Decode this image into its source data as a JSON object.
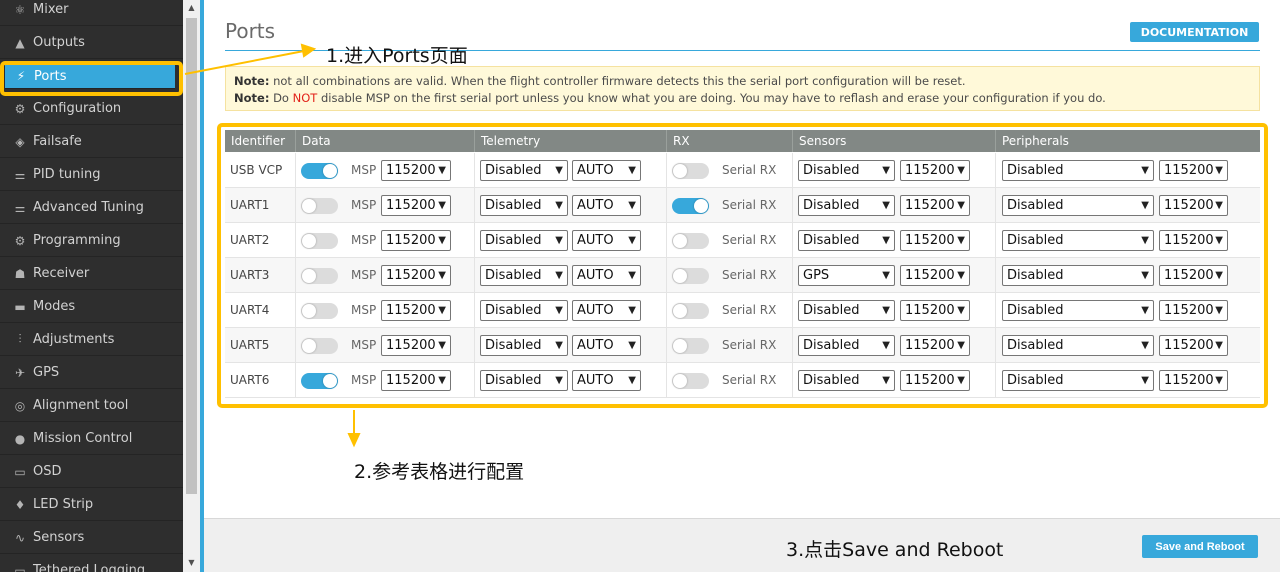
{
  "sidebar": {
    "items": [
      {
        "label": "Mixer",
        "icon": "mixer-icon",
        "glyph": "⚛"
      },
      {
        "label": "Outputs",
        "icon": "outputs-icon",
        "glyph": "▲"
      },
      {
        "label": "Ports",
        "icon": "ports-icon",
        "glyph": "⚡",
        "active": true
      },
      {
        "label": "Configuration",
        "icon": "gear-icon",
        "glyph": "⚙"
      },
      {
        "label": "Failsafe",
        "icon": "failsafe-icon",
        "glyph": "◈"
      },
      {
        "label": "PID tuning",
        "icon": "pid-icon",
        "glyph": "⚌"
      },
      {
        "label": "Advanced Tuning",
        "icon": "advanced-tuning-icon",
        "glyph": "⚌"
      },
      {
        "label": "Programming",
        "icon": "gear-icon",
        "glyph": "⚙"
      },
      {
        "label": "Receiver",
        "icon": "receiver-icon",
        "glyph": "☗"
      },
      {
        "label": "Modes",
        "icon": "modes-icon",
        "glyph": "▬"
      },
      {
        "label": "Adjustments",
        "icon": "adjustments-icon",
        "glyph": "⫶"
      },
      {
        "label": "GPS",
        "icon": "gps-icon",
        "glyph": "✈"
      },
      {
        "label": "Alignment tool",
        "icon": "alignment-icon",
        "glyph": "◎"
      },
      {
        "label": "Mission Control",
        "icon": "map-pin-icon",
        "glyph": "●"
      },
      {
        "label": "OSD",
        "icon": "osd-icon",
        "glyph": "▭"
      },
      {
        "label": "LED Strip",
        "icon": "led-icon",
        "glyph": "♦"
      },
      {
        "label": "Sensors",
        "icon": "sensors-icon",
        "glyph": "∿"
      },
      {
        "label": "Tethered Logging",
        "icon": "logging-icon",
        "glyph": "▭"
      }
    ]
  },
  "header": {
    "title": "Ports",
    "doc_label": "DOCUMENTATION"
  },
  "note": {
    "line1_bold": "Note:",
    "line1": " not all combinations are valid. When the flight controller firmware detects this the serial port configuration will be reset.",
    "line2_bold": "Note:",
    "line2_a": " Do ",
    "line2_red": "NOT",
    "line2_b": " disable MSP on the first serial port unless you know what you are doing. You may have to reflash and erase your configuration if you do."
  },
  "table": {
    "headers": [
      "Identifier",
      "Data",
      "Telemetry",
      "RX",
      "Sensors",
      "Peripherals"
    ],
    "msp_label": "MSP",
    "serial_rx_label": "Serial RX",
    "rows": [
      {
        "id": "USB VCP",
        "msp_on": true,
        "msp_baud": "115200",
        "telemetry": "Disabled",
        "telemetry_baud": "AUTO",
        "rx_on": false,
        "sensors": "Disabled",
        "sensors_baud": "115200",
        "peripherals": "Disabled",
        "peripherals_baud": "115200"
      },
      {
        "id": "UART1",
        "msp_on": false,
        "msp_baud": "115200",
        "telemetry": "Disabled",
        "telemetry_baud": "AUTO",
        "rx_on": true,
        "sensors": "Disabled",
        "sensors_baud": "115200",
        "peripherals": "Disabled",
        "peripherals_baud": "115200"
      },
      {
        "id": "UART2",
        "msp_on": false,
        "msp_baud": "115200",
        "telemetry": "Disabled",
        "telemetry_baud": "AUTO",
        "rx_on": false,
        "sensors": "Disabled",
        "sensors_baud": "115200",
        "peripherals": "Disabled",
        "peripherals_baud": "115200"
      },
      {
        "id": "UART3",
        "msp_on": false,
        "msp_baud": "115200",
        "telemetry": "Disabled",
        "telemetry_baud": "AUTO",
        "rx_on": false,
        "sensors": "GPS",
        "sensors_baud": "115200",
        "peripherals": "Disabled",
        "peripherals_baud": "115200"
      },
      {
        "id": "UART4",
        "msp_on": false,
        "msp_baud": "115200",
        "telemetry": "Disabled",
        "telemetry_baud": "AUTO",
        "rx_on": false,
        "sensors": "Disabled",
        "sensors_baud": "115200",
        "peripherals": "Disabled",
        "peripherals_baud": "115200"
      },
      {
        "id": "UART5",
        "msp_on": false,
        "msp_baud": "115200",
        "telemetry": "Disabled",
        "telemetry_baud": "AUTO",
        "rx_on": false,
        "sensors": "Disabled",
        "sensors_baud": "115200",
        "peripherals": "Disabled",
        "peripherals_baud": "115200"
      },
      {
        "id": "UART6",
        "msp_on": true,
        "msp_baud": "115200",
        "telemetry": "Disabled",
        "telemetry_baud": "AUTO",
        "rx_on": false,
        "sensors": "Disabled",
        "sensors_baud": "115200",
        "peripherals": "Disabled",
        "peripherals_baud": "115200"
      }
    ]
  },
  "annotations": {
    "step1": "1.进入Ports页面",
    "step2": "2.参考表格进行配置",
    "step3": "3.点击Save and Reboot",
    "color": "#ffc000"
  },
  "footer": {
    "save_label": "Save and Reboot"
  },
  "colors": {
    "accent": "#37a8db",
    "sidebar_bg": "#2e2e2e",
    "table_header": "#828885",
    "note_bg": "#fff9d9"
  }
}
